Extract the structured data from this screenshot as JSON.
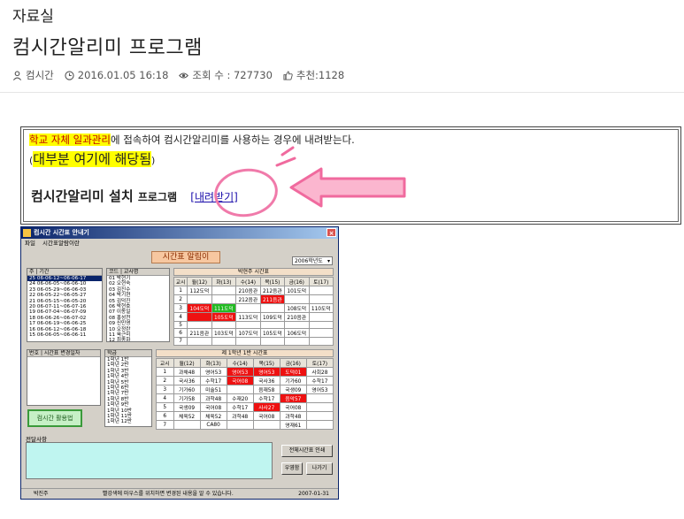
{
  "header": {
    "category": "자료실",
    "title": "컴시간알리미 프로그램",
    "author": "컴시간",
    "datetime": "2016.01.05 16:18",
    "views_label": "조회 수 : 727730",
    "recommend_label": "추천:1128"
  },
  "notice": {
    "line1_highlight": "학교 자체 일과관리",
    "line1_rest": "에 접속하여 컴시간알리미를 사용하는 경우에 내려받는다.",
    "line2_open": "(",
    "line2_highlight": "대부분 여기에 해당됨",
    "line2_close": ")",
    "line3_bold": "컴시간알리미 설치",
    "line3_small": "프로그램",
    "download_link": "[내려받기]"
  },
  "app": {
    "window_title": "컴시간 시간표 안내기",
    "menu": [
      "파일",
      "시간표알람이란"
    ],
    "banner": "시간표 알림이",
    "year_select": "2006학년도",
    "list_panel": {
      "headers": [
        "주",
        "기간"
      ],
      "rows": [
        "25  06-06-12~06-06-17",
        "24  06-06-05~06-06-10",
        "23  06-05-29~06-06-03",
        "22  06-05-22~06-05-27",
        "21  06-05-15~06-05-20",
        "20  06-07-11~06-07-16",
        "19  06-07-04~06-07-09",
        "18  06-06-26~06-07-02",
        "17  06-06-19~06-06-25",
        "16  06-06-12~06-06-18",
        "15  06-06-05~06-06-11"
      ],
      "selected_index": 0
    },
    "teacher_panel": {
      "headers": [
        "코드",
        "교사명"
      ],
      "rows": [
        "01  박현기",
        "02  오현숙",
        "03  김진수",
        "04  박기현",
        "05  김덕진",
        "06  박현호",
        "07  이동일",
        "08  홍성천",
        "09  신민영",
        "10  오정란",
        "11  육근미",
        "12  최종화"
      ]
    },
    "teacher_table": {
      "caption": "박현주 시간표",
      "headers": [
        "교시",
        "월(12)",
        "화(13)",
        "수(14)",
        "목(15)",
        "금(16)",
        "토(17)"
      ],
      "rows": [
        [
          "1",
          "112도덕",
          "",
          "210음관",
          "212음관",
          "101도덕",
          ""
        ],
        [
          "2",
          "",
          "",
          "212음관",
          "211음관",
          "",
          ""
        ],
        [
          "3",
          "104도덕",
          "111도덕",
          "",
          "",
          "108도덕",
          "110도덕"
        ],
        [
          "4",
          "",
          "105도덕",
          "113도덕",
          "109도덕",
          "210음관",
          ""
        ],
        [
          "5",
          "",
          "",
          "",
          "",
          "",
          ""
        ],
        [
          "6",
          "211음관",
          "103도덕",
          "107도덕",
          "105도덕",
          "106도덕",
          ""
        ],
        [
          "7",
          "",
          "",
          "",
          "",
          "",
          ""
        ]
      ],
      "red_cells": [
        [
          1,
          3
        ],
        [
          2,
          0
        ],
        [
          3,
          0
        ],
        [
          3,
          1
        ]
      ],
      "green_cells": [
        [
          2,
          1
        ]
      ]
    },
    "class_panel": {
      "headers": [
        "번호",
        "시간표 변경일자"
      ],
      "rows": []
    },
    "class_list": {
      "header": "학급",
      "rows": [
        "1학년 1반",
        "1학년 2반",
        "1학년 3반",
        "1학년 4반",
        "1학년 5반",
        "1학년 6반",
        "1학년 7반",
        "1학년 8반",
        "1학년 9반",
        "1학년 10반",
        "1학년 11반",
        "1학년 12반"
      ]
    },
    "class_table": {
      "caption": "제 1학년 1반 시간표",
      "headers": [
        "교시",
        "월(12)",
        "화(13)",
        "수(14)",
        "목(15)",
        "금(16)",
        "토(17)"
      ],
      "rows": [
        [
          "1",
          "과채48",
          "영어53",
          "영어53",
          "영어53",
          "도덕01",
          "사회28"
        ],
        [
          "2",
          "국사36",
          "수학17",
          "국어08",
          "국사36",
          "기가60",
          "수학17"
        ],
        [
          "3",
          "기가60",
          "미술51",
          "",
          "음재58",
          "국생09",
          "영어53"
        ],
        [
          "4",
          "기가58",
          "과학48",
          "수재20",
          "수학17",
          "음악57",
          ""
        ],
        [
          "5",
          "국생09",
          "국어08",
          "수학17",
          "사사27",
          "국어08",
          ""
        ],
        [
          "6",
          "체육52",
          "체육52",
          "과학48",
          "국어08",
          "과학48",
          ""
        ],
        [
          "7",
          "",
          "CA80",
          "",
          "",
          "영재61",
          ""
        ]
      ],
      "red_cells": [
        [
          0,
          2
        ],
        [
          0,
          3
        ],
        [
          0,
          4
        ],
        [
          1,
          2
        ],
        [
          1,
          6
        ],
        [
          3,
          4
        ],
        [
          4,
          3
        ]
      ],
      "green_cells": [
        [
          2,
          6
        ]
      ]
    },
    "green_button": "컴시간 활용법",
    "memo_label": "전달사항",
    "print_button": "전체시간표 인쇄",
    "prefs_button": "우영함",
    "exit_button": "나가기",
    "status_left": "박진주",
    "status_center": "빨강색에 마우스를 위치하면 변경된 내용을 알 수 있습니다.",
    "status_right": "2007-01-31"
  }
}
